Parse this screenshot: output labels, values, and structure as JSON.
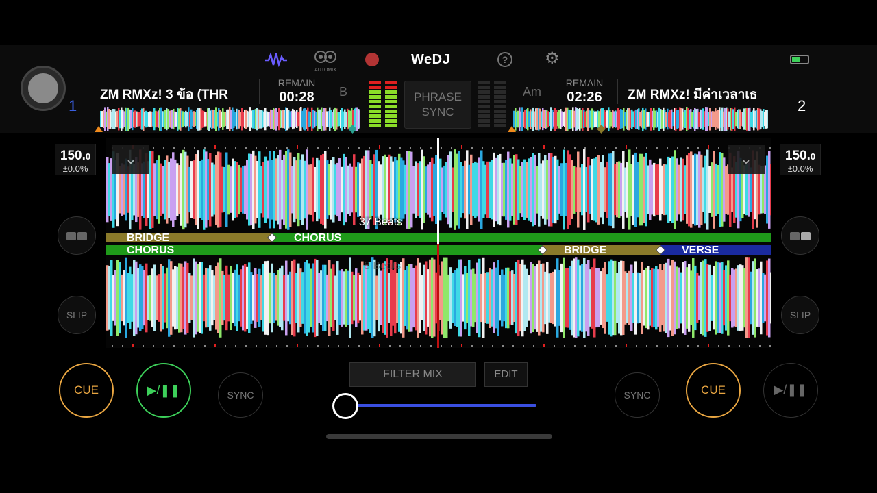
{
  "app": {
    "name": "WeDJ"
  },
  "toolbar": {
    "waveform_icon": "waveform-icon",
    "automix_label": "AUTOMIX",
    "record_icon": "record-icon",
    "help_icon": "help-icon",
    "settings_icon": "gear-icon",
    "battery_icon": "battery-icon"
  },
  "deck1": {
    "number": "1",
    "title": "ZM RMXz! 3 ข้อ (THR",
    "remain_label": "REMAIN",
    "remain_time": "00:28",
    "key": "B",
    "bpm": "150.",
    "bpm_decimal": "0",
    "pitch": "±0.0%",
    "slip_label": "SLIP",
    "cue_label": "CUE",
    "play_label": "▶/❚❚",
    "sync_label": "SYNC"
  },
  "deck2": {
    "number": "2",
    "title": "ZM RMXz! มีค่าเวลาเธ",
    "remain_label": "REMAIN",
    "remain_time": "02:26",
    "key": "Am",
    "bpm": "150.",
    "bpm_decimal": "0",
    "pitch": "±0.0%",
    "slip_label": "SLIP",
    "cue_label": "CUE",
    "play_label": "▶/❚❚",
    "sync_label": "SYNC"
  },
  "center": {
    "phrase_sync_line1": "PHRASE",
    "phrase_sync_line2": "SYNC",
    "beats_label": "37 Beats",
    "beats_label_ghost": "8 Beats",
    "filter_mix_label": "FILTER MIX",
    "edit_label": "EDIT",
    "crossfader_value": 0
  },
  "phrases": {
    "deck1": [
      "BRIDGE",
      "CHORUS"
    ],
    "deck2": [
      "CHORUS",
      "BRIDGE",
      "VERSE"
    ]
  },
  "colors": {
    "cue": "#e9a642",
    "play_active": "#3dd05a",
    "phrase_bridge": "#8a7a2a",
    "phrase_chorus": "#1f9a1a",
    "phrase_verse": "#1a2aa0",
    "crossfader": "#3a4fe0",
    "playhead_top": "#ffffff",
    "playhead_bottom": "#c01010"
  }
}
